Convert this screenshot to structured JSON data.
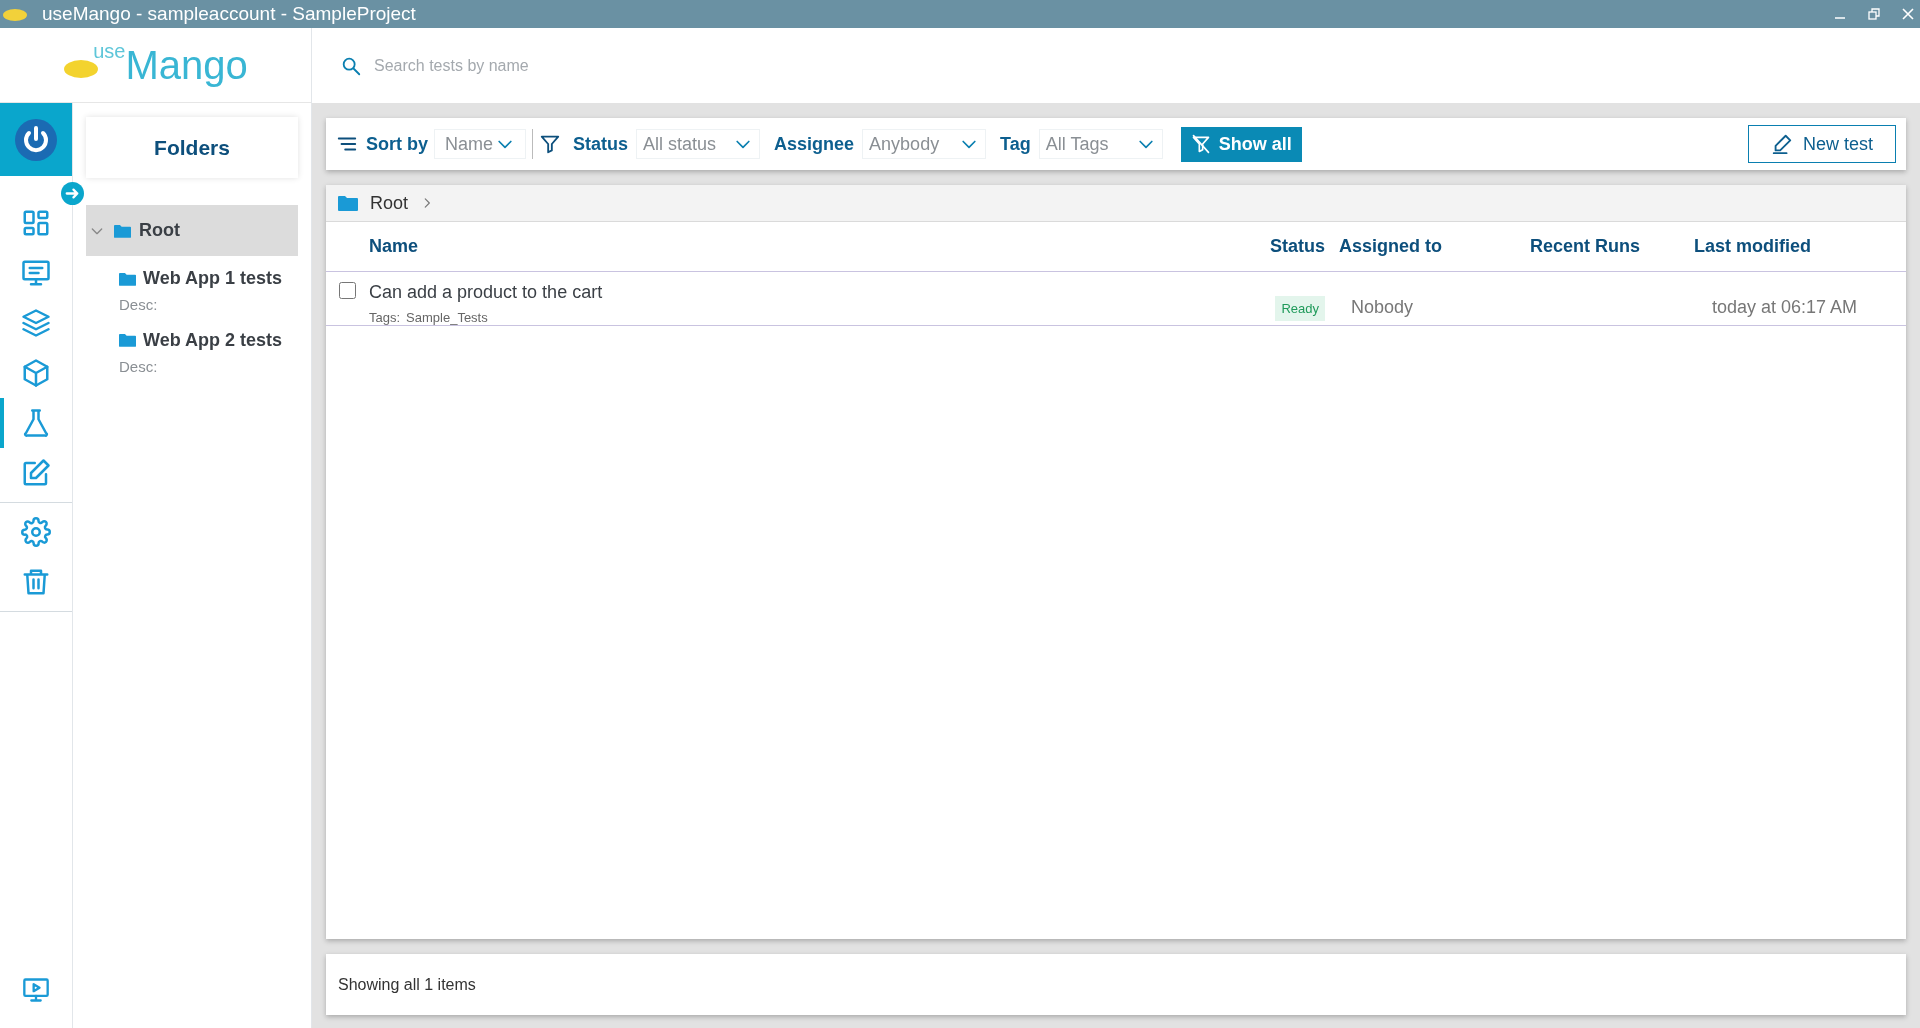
{
  "window": {
    "title": "useMango - sampleaccount - SampleProject"
  },
  "logo": {
    "prefix": "use",
    "name": "Mango"
  },
  "search": {
    "placeholder": "Search tests by name"
  },
  "nav": [
    {
      "kind": "dashboard",
      "selected": false
    },
    {
      "kind": "monitor",
      "selected": false
    },
    {
      "kind": "layers",
      "selected": false
    },
    {
      "kind": "package",
      "selected": false
    },
    {
      "kind": "flask",
      "selected": true
    },
    {
      "kind": "edit",
      "selected": false
    },
    {
      "kind": "settings",
      "selected": false
    },
    {
      "kind": "trash",
      "selected": false
    }
  ],
  "folders": {
    "title": "Folders",
    "tree": [
      {
        "label": "Root",
        "expanded": true,
        "selected": true,
        "children": [
          {
            "label": "Web App 1 tests",
            "desc": "Desc:",
            "selected": false
          },
          {
            "label": "Web App 2 tests",
            "desc": "Desc:",
            "selected": false
          }
        ]
      }
    ]
  },
  "toolbar": {
    "sort": {
      "label": "Sort by",
      "value": "Name"
    },
    "filters": [
      {
        "label": "Status",
        "value": "All status"
      },
      {
        "label": "Assignee",
        "value": "Anybody"
      },
      {
        "label": "Tag",
        "value": "All Tags"
      }
    ],
    "show_all": "Show all",
    "new_test": "New test"
  },
  "breadcrumb": [
    "Root"
  ],
  "table": {
    "columns": [
      "Name",
      "Status",
      "Assigned to",
      "Recent Runs",
      "Last modified"
    ],
    "rows": [
      {
        "name": "Can add a product to the cart",
        "tags_label": "Tags:",
        "tags": "Sample_Tests",
        "status": "Ready",
        "assigned": "Nobody",
        "modified": "today at 06:17 AM",
        "checked": false
      }
    ]
  },
  "footer": "Showing all 1 items"
}
